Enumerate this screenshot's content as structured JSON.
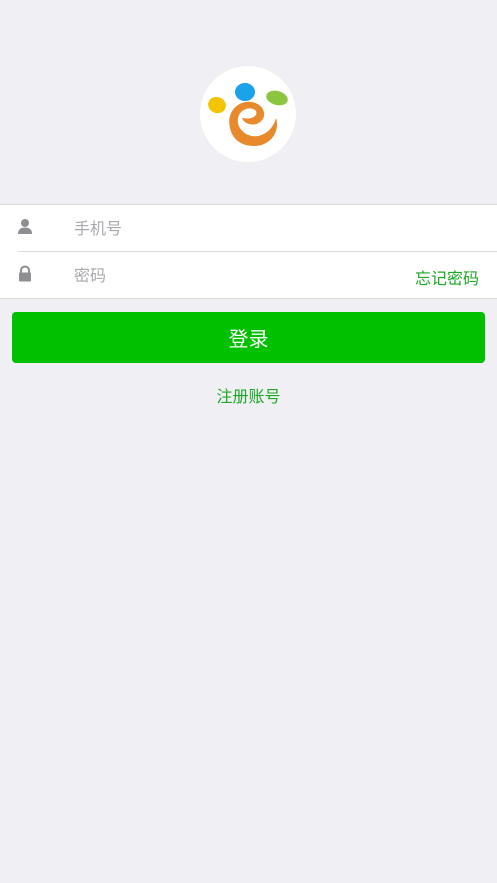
{
  "colors": {
    "background": "#efeff4",
    "accent": "#00c000",
    "link": "#1ba823",
    "placeholder": "#a8a8ad",
    "icon": "#8e8e93"
  },
  "logo": {
    "icon": "leaf-e-logo-icon"
  },
  "form": {
    "phone": {
      "icon": "user-icon",
      "value": "",
      "placeholder": "手机号"
    },
    "password": {
      "icon": "lock-icon",
      "value": "",
      "placeholder": "密码"
    },
    "forgot_label": "忘记密码"
  },
  "actions": {
    "login_label": "登录",
    "register_label": "注册账号"
  }
}
